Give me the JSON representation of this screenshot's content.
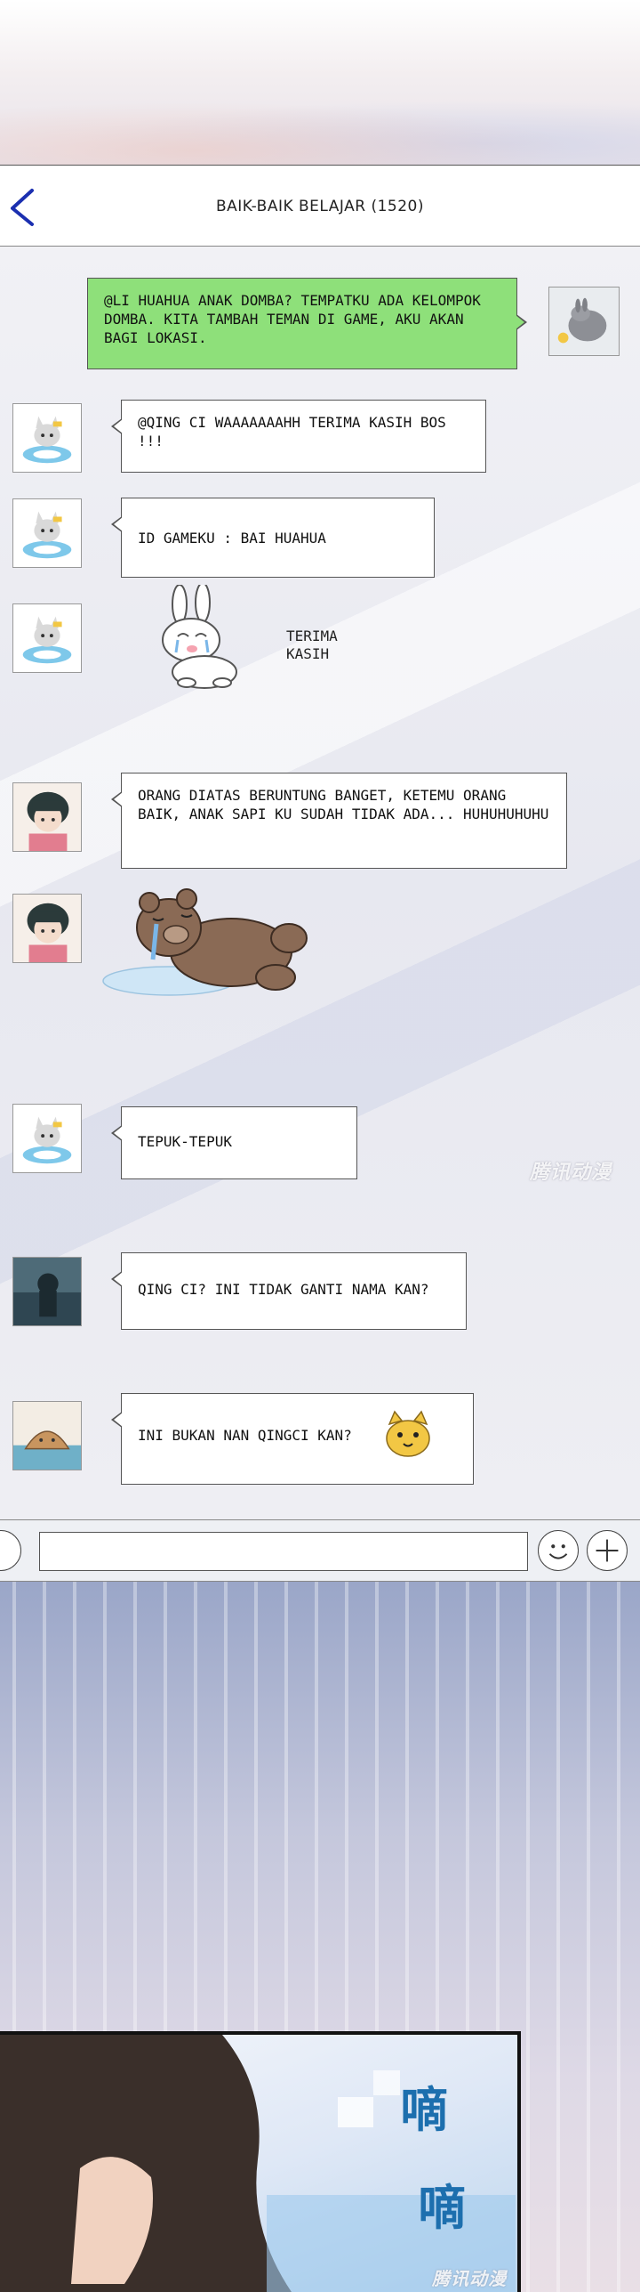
{
  "header": {
    "title": "BAIK-BAIK BELAJAR (1520)",
    "back_icon": "chevron-left-icon",
    "accent_color": "#1b2fb0"
  },
  "messages": [
    {
      "side": "right",
      "text": "@LI HUAHUA ANAK DOMBA? TEMPATKU ADA KELOMPOK DOMBA. KITA TAMBAH TEMAN DI GAME, AKU AKAN BAGI LOKASI.",
      "bubble_color": "#8ee07a"
    },
    {
      "side": "left",
      "text": "@QING CI WAAAAAAAHH TERIMA KASIH BOS !!!"
    },
    {
      "side": "left",
      "text": "ID GAMEKU : BAI HUAHUA"
    },
    {
      "side": "left",
      "sticker": "crying-rabbit-sticker",
      "sticker_text": "TERIMA KASIH"
    },
    {
      "side": "left",
      "text": "ORANG DIATAS BERUNTUNG BANGET, KETEMU ORANG BAIK, ANAK SAPI KU SUDAH TIDAK ADA... HUHUHUHUHU"
    },
    {
      "side": "left",
      "sticker": "crying-bear-sticker"
    },
    {
      "side": "left",
      "text": "TEPUK-TEPUK"
    },
    {
      "side": "left",
      "text": "QING CI? INI TIDAK GANTI NAMA KAN?"
    },
    {
      "side": "left",
      "text": "INI BUKAN NAN QINGCI KAN?",
      "emoji": "cat-face-emoji"
    }
  ],
  "input_bar": {
    "placeholder": "",
    "emoji_button_icon": "smiley-icon",
    "add_button_icon": "plus-circle-icon"
  },
  "watermark": "腾讯动漫",
  "sound_effect": [
    "嘀",
    "嘀"
  ]
}
